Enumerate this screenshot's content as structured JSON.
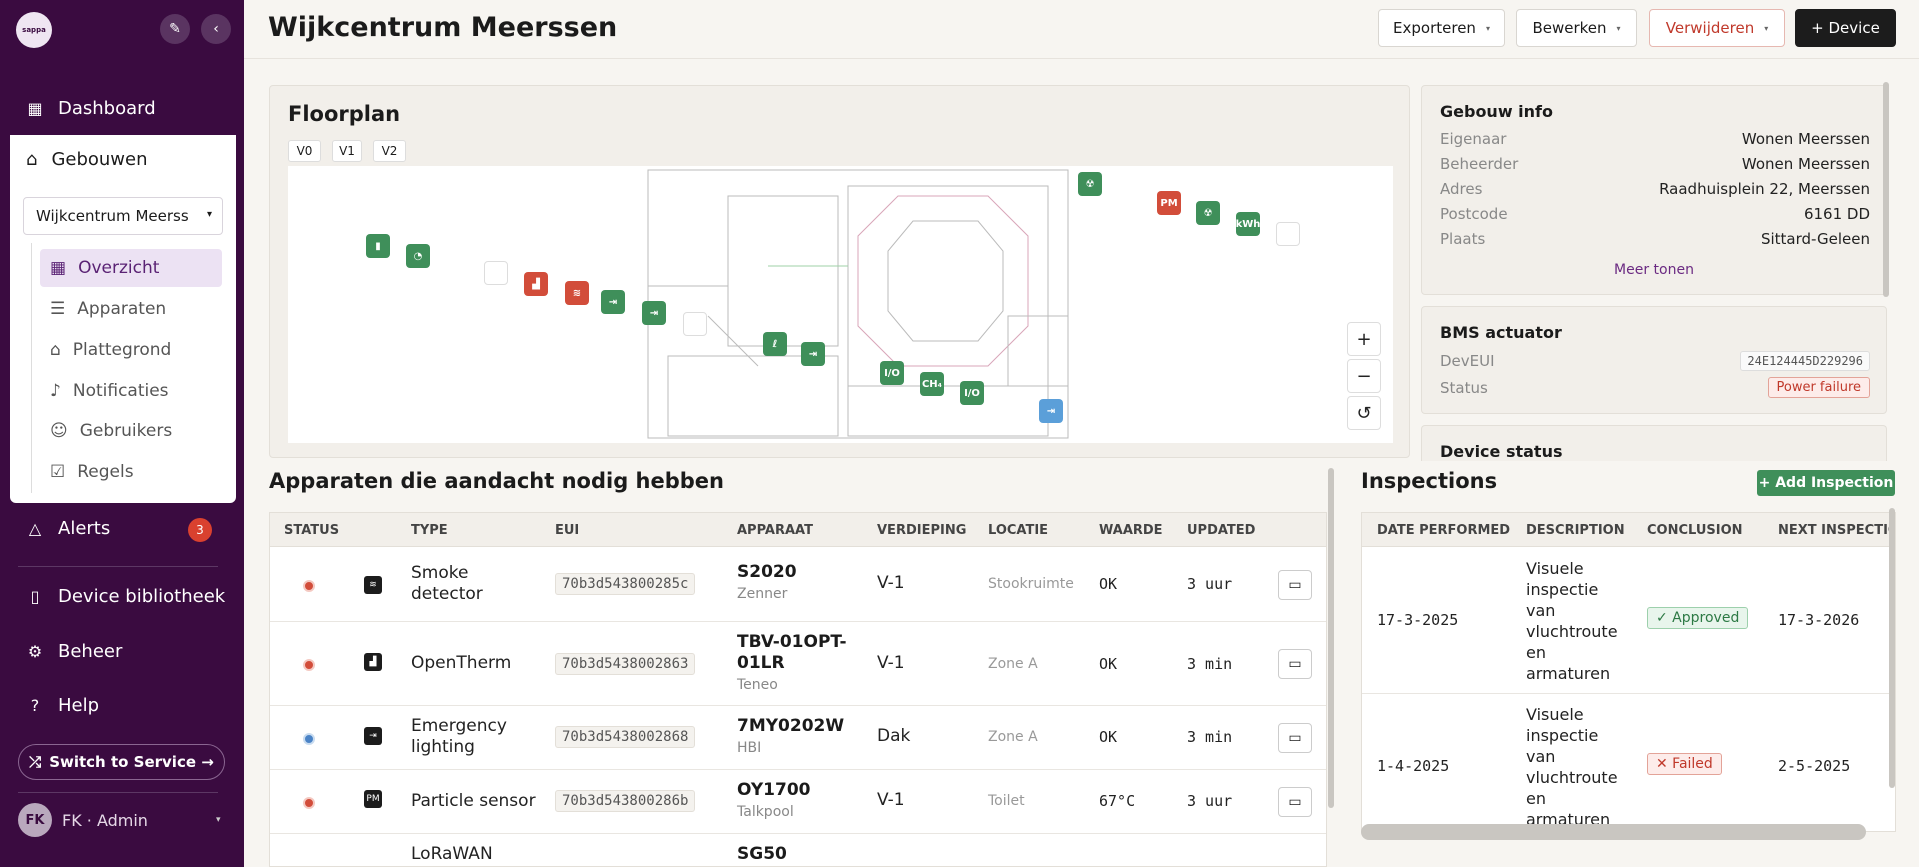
{
  "sidebar": {
    "logo": "sappa",
    "pin_icon": "pin-icon",
    "collapse_icon": "chevron-left-icon",
    "dashboard": "Dashboard",
    "gebouwen": "Gebouwen",
    "building_select": "Wijkcentrum Meerss",
    "sub_items": [
      "Overzicht",
      "Apparaten",
      "Plattegrond",
      "Notificaties",
      "Gebruikers",
      "Regels"
    ],
    "alerts": "Alerts",
    "alerts_count": "3",
    "library": "Device bibliotheek",
    "beheer": "Beheer",
    "help": "Help",
    "switch": "Switch to Service →",
    "user_initials": "FK",
    "user_label": "FK · Admin"
  },
  "header": {
    "title": "Wijkcentrum Meerssen",
    "export": "Exporteren",
    "edit": "Bewerken",
    "delete": "Verwijderen",
    "add_device": "+ Device"
  },
  "floorplan": {
    "title": "Floorplan",
    "tabs": [
      "V0",
      "V1",
      "V2"
    ],
    "zoom_in": "+",
    "zoom_out": "−",
    "reset": "↺",
    "marker_labels": {
      "io": "I/O",
      "kwh": "kWh",
      "ch4": "CH₄",
      "pm": "PM"
    }
  },
  "building_info": {
    "title": "Gebouw info",
    "rows": [
      {
        "k": "Eigenaar",
        "v": "Wonen Meerssen"
      },
      {
        "k": "Beheerder",
        "v": "Wonen Meerssen"
      },
      {
        "k": "Adres",
        "v": "Raadhuisplein 22, Meerssen"
      },
      {
        "k": "Postcode",
        "v": "6161 DD"
      },
      {
        "k": "Plaats",
        "v": "Sittard-Geleen"
      }
    ],
    "more": "Meer tonen"
  },
  "bms": {
    "title": "BMS actuator",
    "deveui_label": "DevEUI",
    "deveui": "24E124445D229296",
    "status_label": "Status",
    "status": "Power failure"
  },
  "device_status": {
    "title": "Device status"
  },
  "devices": {
    "title": "Apparaten die aandacht nodig hebben",
    "columns": [
      "STATUS",
      "TYPE",
      "EUI",
      "APPARAAT",
      "VERDIEPING",
      "LOCATIE",
      "WAARDE",
      "UPDATED"
    ],
    "rows": [
      {
        "status": "red",
        "type1": "Smoke",
        "type2": "detector",
        "eui": "70b3d543800285c",
        "name1": "S2020",
        "name2": "",
        "brand": "Zenner",
        "floor": "V-1",
        "loc": "Stookruimte",
        "value": "OK",
        "updated": "3 uur"
      },
      {
        "status": "red",
        "type1": "OpenTherm",
        "type2": "",
        "eui": "70b3d5438002863",
        "name1": "TBV-01OPT-",
        "name2": "01LR",
        "brand": "Teneo",
        "floor": "V-1",
        "loc": "Zone A",
        "value": "OK",
        "updated": "3 min"
      },
      {
        "status": "blue",
        "type1": "Emergency",
        "type2": "lighting",
        "eui": "70b3d5438002868",
        "name1": "7MY0202W",
        "name2": "",
        "brand": "HBI",
        "floor": "Dak",
        "loc": "Zone A",
        "value": "OK",
        "updated": "3 min"
      },
      {
        "status": "red",
        "type1": "Particle sensor",
        "type2": "",
        "eui": "70b3d543800286b",
        "name1": "OY1700",
        "name2": "",
        "brand": "Talkpool",
        "floor": "V-1",
        "loc": "Toilet",
        "value": "67°C",
        "updated": "3 uur"
      },
      {
        "status": "red",
        "type1": "LoRaWAN",
        "type2": "",
        "eui": "",
        "name1": "SG50",
        "name2": "",
        "brand": "",
        "floor": "",
        "loc": "",
        "value": "",
        "updated": ""
      }
    ]
  },
  "inspections": {
    "title": "Inspections",
    "add": "+ Add Inspection",
    "columns": [
      "DATE PERFORMED",
      "DESCRIPTION",
      "CONCLUSION",
      "NEXT INSPECTION"
    ],
    "rows": [
      {
        "date": "17-3-2025",
        "desc": [
          "Visuele",
          "inspectie",
          "van",
          "vluchtroute",
          "en",
          "armaturen"
        ],
        "conclusion": "✓ Approved",
        "next": "17-3-2026"
      },
      {
        "date": "1-4-2025",
        "desc": [
          "Visuele",
          "inspectie",
          "van",
          "vluchtroute",
          "en",
          "armaturen"
        ],
        "conclusion": "✕ Failed",
        "next": "2-5-2025"
      }
    ]
  }
}
